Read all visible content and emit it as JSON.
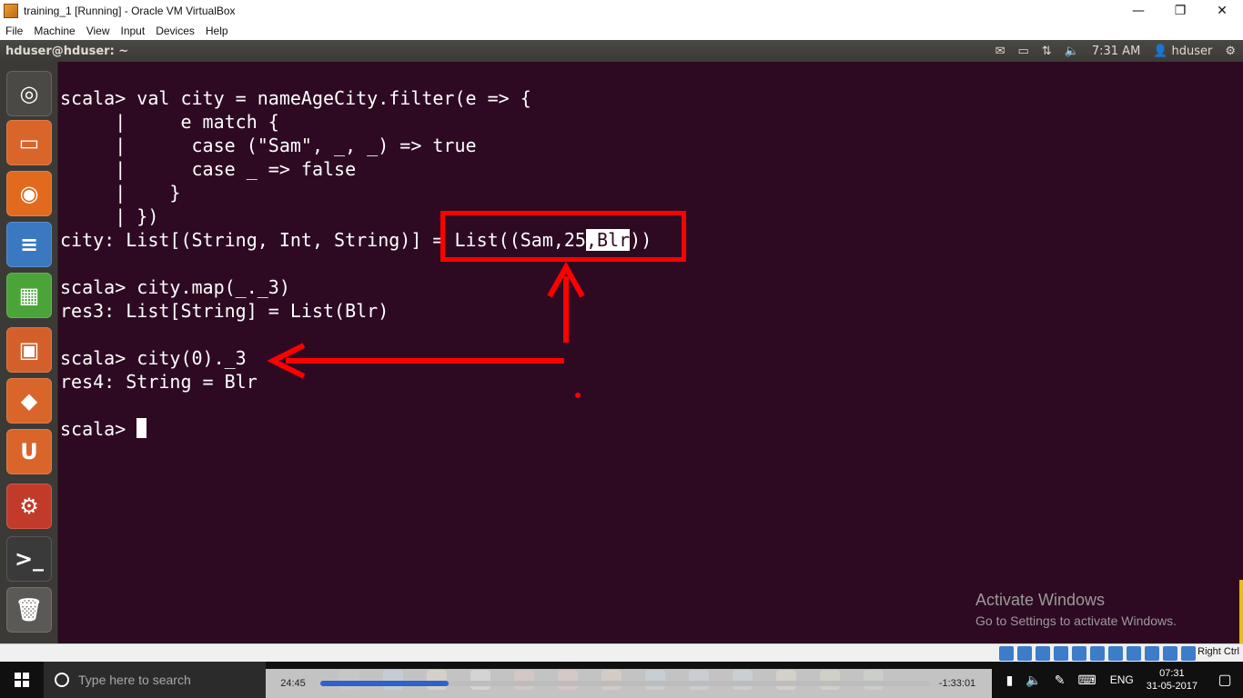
{
  "window": {
    "title": "training_1 [Running] - Oracle VM VirtualBox",
    "minimize": "—",
    "maximize": "❐",
    "close": "✕"
  },
  "menubar": [
    "File",
    "Machine",
    "View",
    "Input",
    "Devices",
    "Help"
  ],
  "ubuntu_panel": {
    "title": "hduser@hduser: ~",
    "time": "7:31 AM",
    "user": "hduser",
    "icons": [
      "mail-icon",
      "battery-icon",
      "network-icon",
      "volume-icon",
      "settings-gear-icon"
    ]
  },
  "launcher": [
    {
      "name": "ubuntu-dash-icon",
      "glyph": "◎",
      "color": "#4a4946"
    },
    {
      "name": "files-icon",
      "glyph": "▭",
      "color": "#d9652b"
    },
    {
      "name": "firefox-icon",
      "glyph": "◉",
      "color": "#e16a1f"
    },
    {
      "name": "writer-icon",
      "glyph": "≡",
      "color": "#3b78c2"
    },
    {
      "name": "calc-icon",
      "glyph": "▦",
      "color": "#4aa438"
    },
    {
      "name": "impress-icon",
      "glyph": "▣",
      "color": "#d3602a"
    },
    {
      "name": "software-center-icon",
      "glyph": "◆",
      "color": "#d9652b"
    },
    {
      "name": "ubuntu-one-icon",
      "glyph": "U",
      "color": "#d9652b"
    },
    {
      "name": "system-settings-icon",
      "glyph": "⚙",
      "color": "#c23b2a"
    },
    {
      "name": "terminal-icon",
      "glyph": ">_",
      "color": "#3a3a3a"
    },
    {
      "name": "trash-icon",
      "glyph": "🗑",
      "color": "#5a5955"
    }
  ],
  "terminal": {
    "lines": [
      "scala> val city = nameAgeCity.filter(e => {",
      "     |     e match {",
      "     |      case (\"Sam\", _, _) => true",
      "     |      case _ => false",
      "     |    }",
      "     | })",
      "city: List[(String, Int, String)] = ",
      "",
      "scala> city.map(_._3)",
      "res3: List[String] = List(Blr)",
      "",
      "scala> city(0)._3",
      "res4: String = Blr",
      "",
      "scala> "
    ],
    "list_prefix": "List((Sam,25",
    "list_highlight": ",Blr",
    "list_suffix": "))"
  },
  "watermark": {
    "line1": "Activate Windows",
    "line2": "Go to Settings to activate Windows."
  },
  "vb_status": {
    "host_key": "Right Ctrl"
  },
  "taskbar": {
    "search_placeholder": "Type here to search",
    "language": "ENG",
    "clock_time": "07:31",
    "clock_date": "31-05-2017"
  },
  "player": {
    "elapsed": "24:45",
    "remaining": "-1:33:01",
    "progress_fraction": 0.21
  },
  "colors": {
    "terminal_bg": "#2d0a22",
    "annotation": "#ff0000"
  }
}
